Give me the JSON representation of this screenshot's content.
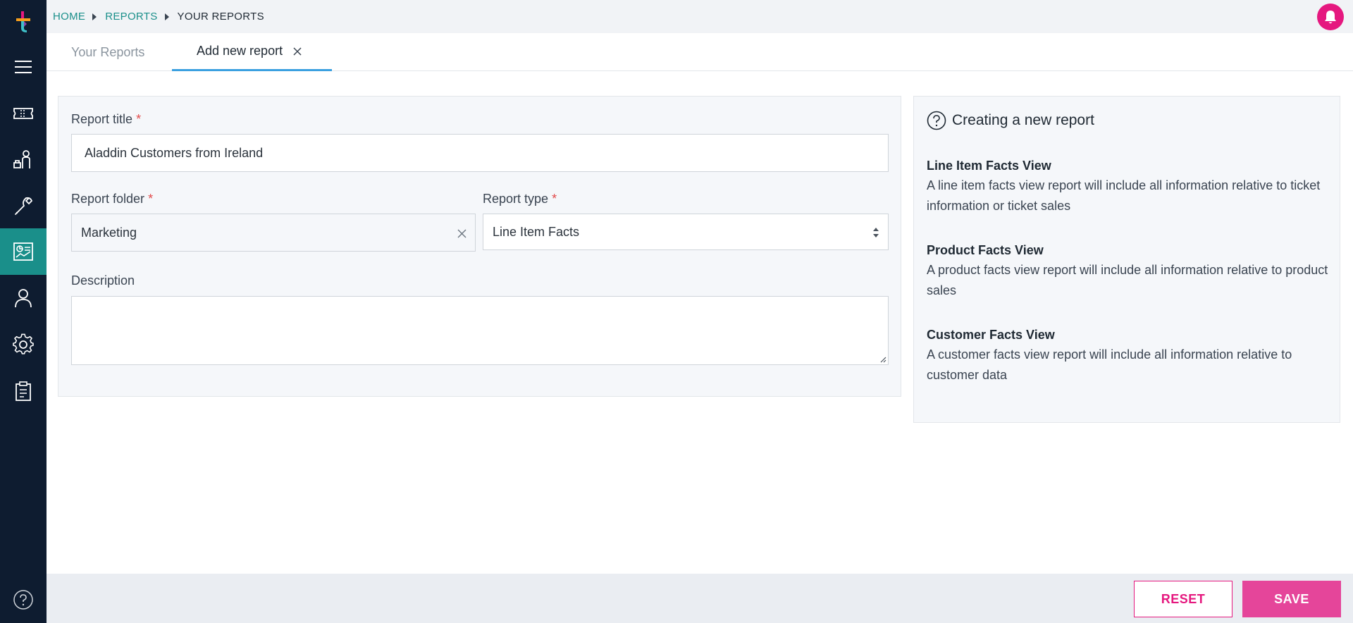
{
  "breadcrumb": {
    "home": "HOME",
    "reports": "REPORTS",
    "current": "YOUR REPORTS"
  },
  "tabs": [
    {
      "label": "Your Reports"
    },
    {
      "label": "Add new report"
    }
  ],
  "form": {
    "title_label": "Report title",
    "title_value": "Aladdin Customers from Ireland",
    "folder_label": "Report folder",
    "folder_value": "Marketing",
    "type_label": "Report type",
    "type_value": "Line Item Facts",
    "description_label": "Description",
    "description_value": "",
    "required_mark": "*"
  },
  "info": {
    "title": "Creating a new report",
    "sections": [
      {
        "heading": "Line Item Facts View",
        "text": "A line item facts view report will include all information relative to ticket information or ticket sales"
      },
      {
        "heading": "Product Facts View",
        "text": "A product facts view report will include all information relative to product sales"
      },
      {
        "heading": "Customer Facts View",
        "text": "A customer facts view report will include all information relative to customer data"
      }
    ]
  },
  "footer": {
    "reset_label": "RESET",
    "save_label": "SAVE"
  },
  "colors": {
    "sidebar": "#0e1c30",
    "active_nav": "#1a8f8a",
    "accent_pink": "#e5187f",
    "tab_underline": "#3aa0e0"
  },
  "icons": {
    "nav": [
      "menu-icon",
      "ticket-icon",
      "customer-service-icon",
      "wrench-icon",
      "reports-icon",
      "user-icon",
      "gear-icon",
      "clipboard-icon"
    ],
    "help": "question-circle-icon",
    "bell": "bell-icon"
  }
}
